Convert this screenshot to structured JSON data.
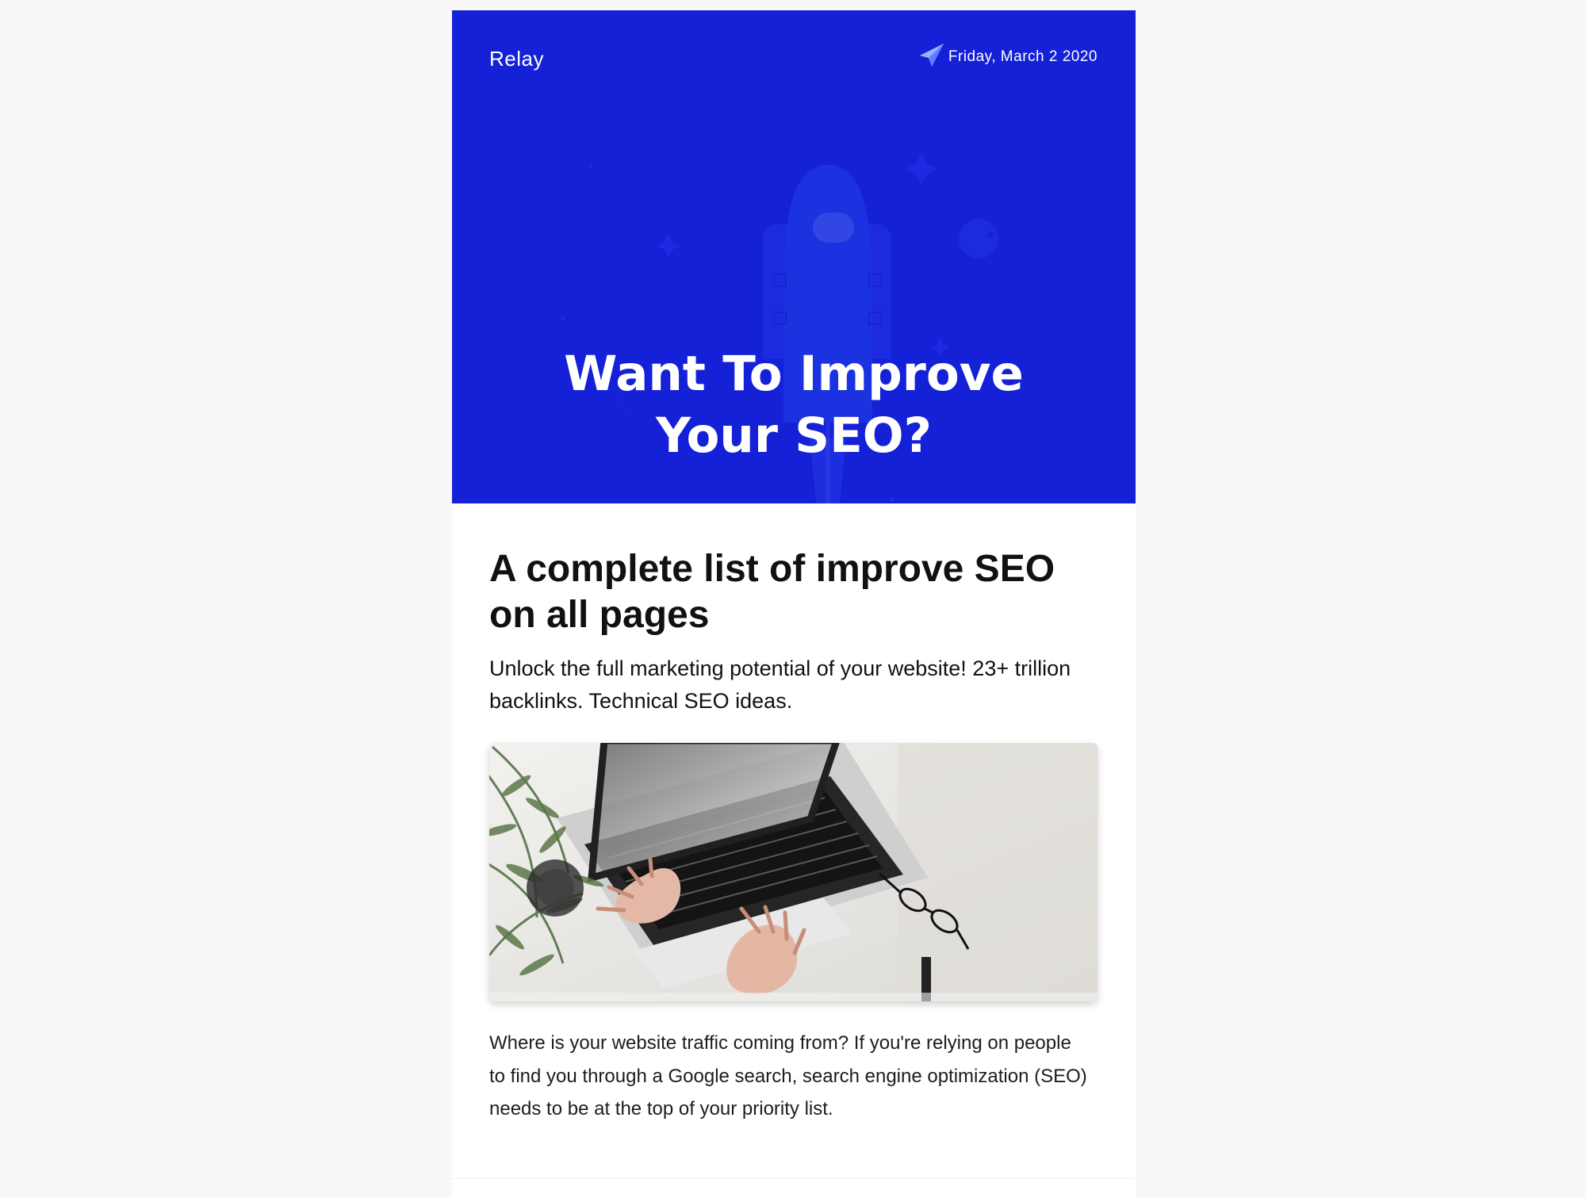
{
  "email": {
    "brand": "Relay",
    "date": "Friday, March 2 2020",
    "hero_title_line1": "Want To Improve",
    "hero_title_line2": "Your SEO?",
    "headline": "A complete list of improve SEO on all pages",
    "subhead": "Unlock the full marketing potential of your website! 23+ trillion backlinks. Technical SEO ideas.",
    "body": "Where is your website traffic coming from? If you're relying on people to find you through a Google search, search engine optimization (SEO) needs to be at the top of your priority list."
  },
  "icons": {
    "date": "paper-plane-icon",
    "hero_art": "rocket-icon",
    "photo": "laptop-photo"
  },
  "colors": {
    "hero_background": "#1421d6",
    "page_background": "#f8f8f8",
    "card_background": "#ffffff",
    "text": "#111111"
  }
}
